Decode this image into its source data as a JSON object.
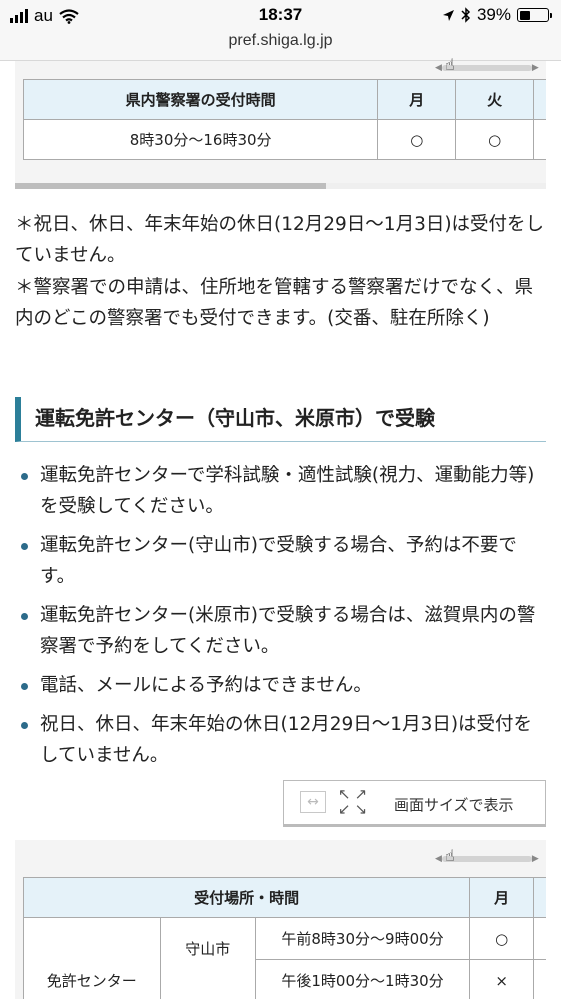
{
  "status": {
    "carrier": "au",
    "time": "18:37",
    "battery_text": "39%",
    "battery_level": 0.39
  },
  "url": "pref.shiga.lg.jp",
  "table1": {
    "headers": [
      "県内警察署の受付時間",
      "月",
      "火"
    ],
    "row": [
      "8時30分〜16時30分",
      "○",
      "○"
    ]
  },
  "notes": {
    "line1": "＊祝日、休日、年末年始の休日(12月29日〜1月3日)は受付をしていません。",
    "line2": "＊警察署での申請は、住所地を管轄する警察署だけでなく、県内のどこの警察署でも受付できます。(交番、駐在所除く)"
  },
  "section_heading": "運転免許センター（守山市、米原市）で受験",
  "bullets": [
    "運転免許センターで学科試験・適性試験(視力、運動能力等)を受験してください。",
    "運転免許センター(守山市)で受験する場合、予約は不要です。",
    "運転免許センター(米原市)で受験する場合は、滋賀県内の警察署で予約をしてください。",
    "電話、メールによる予約はできません。",
    "祝日、休日、年末年始の休日(12月29日〜1月3日)は受付をしていません。"
  ],
  "view_button": {
    "label": "画面サイズで表示",
    "icons": [
      "expand-horizontal-icon",
      "fullscreen-icon"
    ]
  },
  "table2": {
    "headers": [
      "受付場所・時間",
      "月"
    ],
    "place": "免許センター",
    "city": "守山市",
    "rows": [
      {
        "time": "午前8時30分〜9時00分",
        "mon": "○"
      },
      {
        "time": "午後1時00分〜1時30分",
        "mon": "×"
      }
    ]
  },
  "colors": {
    "accent": "#2c7f99",
    "table_header_bg": "#e5f2f9"
  }
}
